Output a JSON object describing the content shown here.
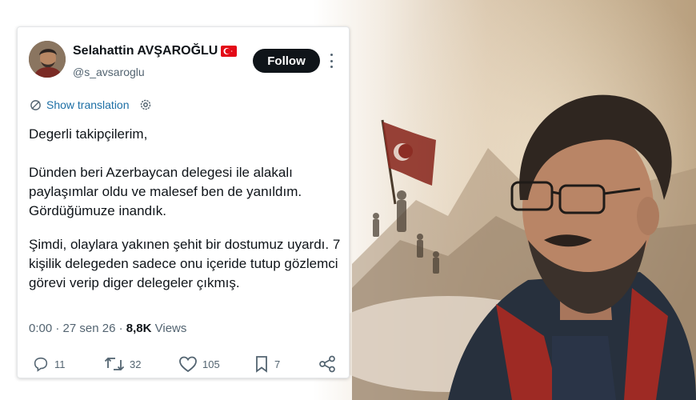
{
  "tweet": {
    "display_name": "Selahattin AVŞAROĞLU",
    "handle": "@s_avsaroglu",
    "follow_label": "Follow",
    "translate_label": "Show translation",
    "paragraphs": [
      "Degerli takipçilerim,",
      "Dünden beri Azerbaycan delegesi ile alakalı paylaşımlar oldu ve malesef ben de yanıldım. Gördüğümuze inandık.",
      "Şimdi, olaylara yakınen şehit bir dostumuz uyardı. 7 kişilik delegeden sadece onu içeride tutup gözlemci görevi verip diger delegeler çıkmış."
    ],
    "time": "0:00",
    "date": "27 sen 26",
    "views_count": "8,8K",
    "views_label": "Views",
    "replies": "11",
    "reposts": "32",
    "likes": "105",
    "bookmarks": "7"
  },
  "icons": [
    "avatar",
    "turkey-flag-icon",
    "more-icon",
    "translate-icon",
    "settings-icon",
    "reply-icon",
    "repost-icon",
    "like-icon",
    "bookmark-icon",
    "share-icon"
  ],
  "colors": {
    "follow_bg": "#0f1419",
    "link": "#1d6fa5",
    "muted": "#536471",
    "text": "#0f1419"
  }
}
